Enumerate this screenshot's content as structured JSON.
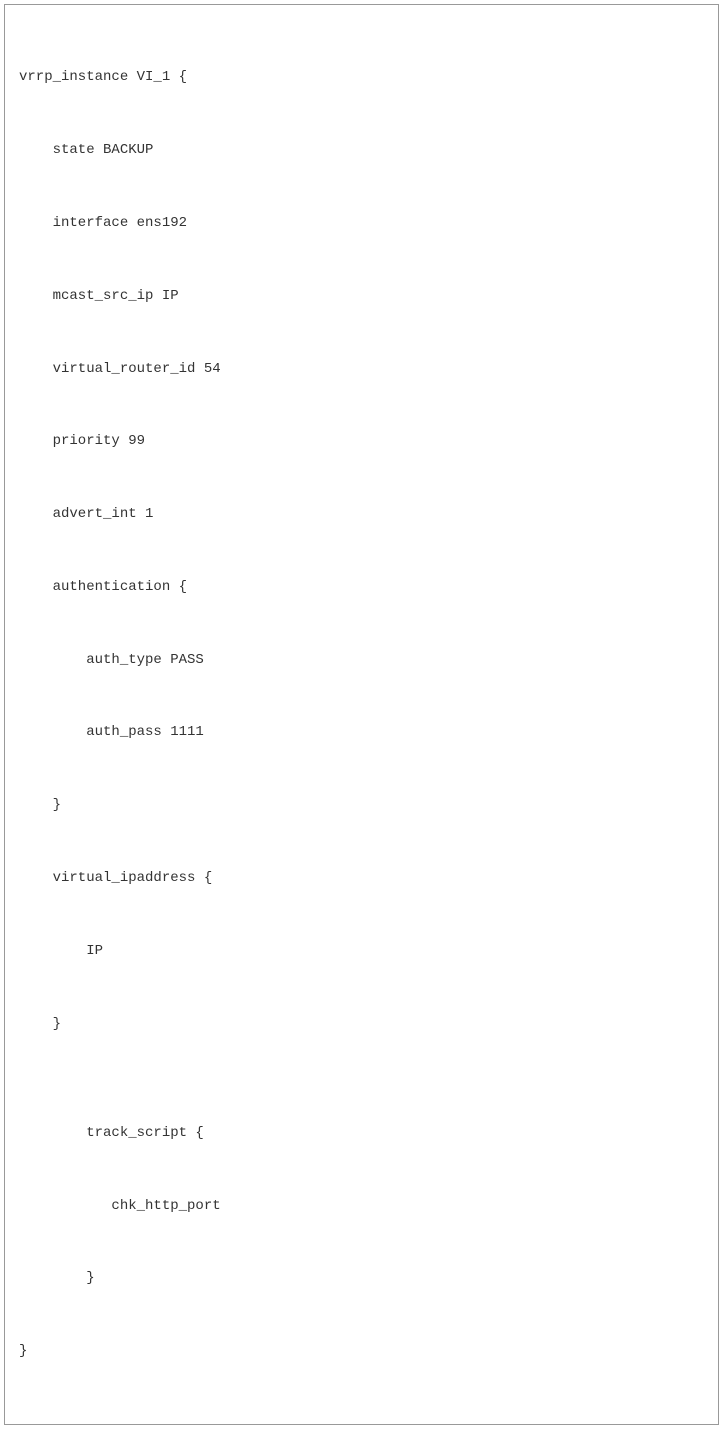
{
  "code": {
    "lines": [
      "vrrp_instance VI_1 {",
      "    state BACKUP",
      "    interface ens192",
      "    mcast_src_ip IP",
      "    virtual_router_id 54",
      "    priority 99",
      "    advert_int 1",
      "    authentication {",
      "        auth_type PASS",
      "        auth_pass 1111",
      "    }",
      "    virtual_ipaddress {",
      "        IP",
      "    }",
      "",
      "        track_script {",
      "           chk_http_port",
      "        }",
      "}"
    ]
  }
}
